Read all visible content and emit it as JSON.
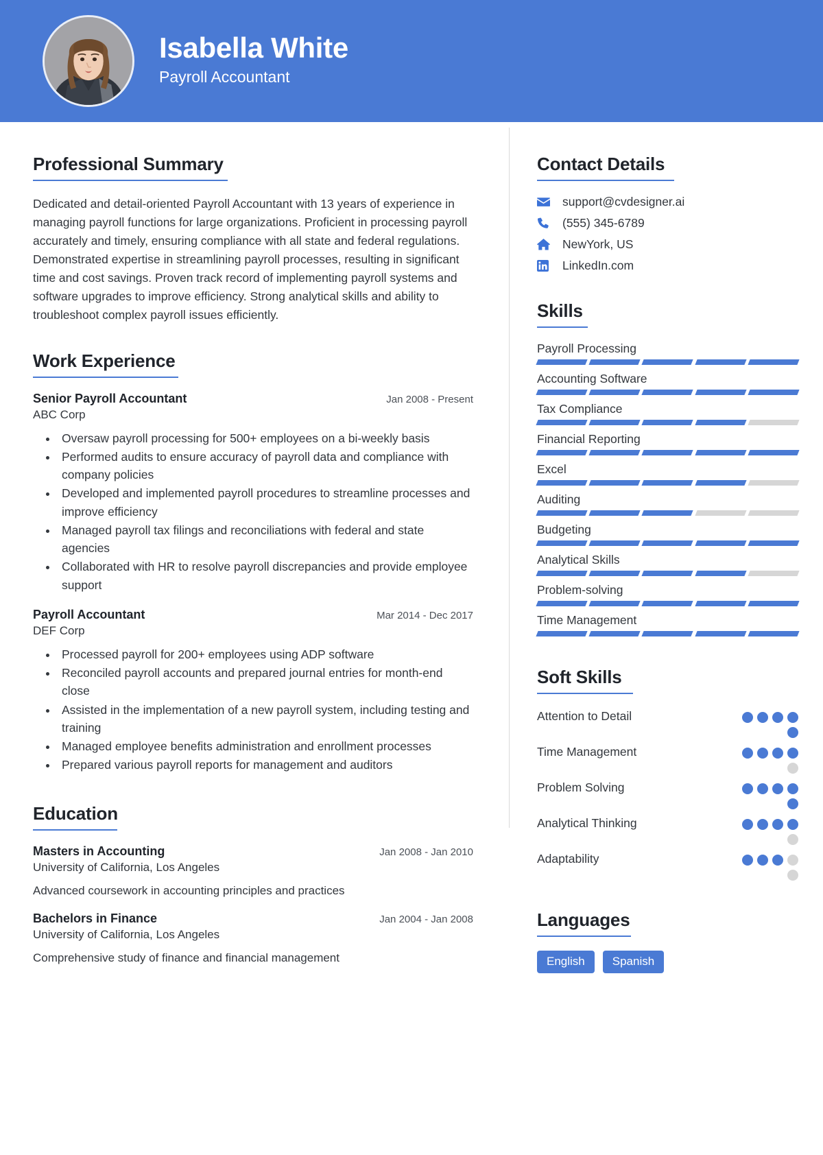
{
  "theme": {
    "accent": "#4a7ad4",
    "bar_empty": "#d6d6d6",
    "text": "#33373d"
  },
  "header": {
    "name": "Isabella White",
    "role": "Payroll Accountant"
  },
  "summary": {
    "heading": "Professional Summary",
    "text": "Dedicated and detail-oriented Payroll Accountant with 13 years of experience in managing payroll functions for large organizations. Proficient in processing payroll accurately and timely, ensuring compliance with all state and federal regulations. Demonstrated expertise in streamlining payroll processes, resulting in significant time and cost savings. Proven track record of implementing payroll systems and software upgrades to improve efficiency. Strong analytical skills and ability to troubleshoot complex payroll issues efficiently."
  },
  "work": {
    "heading": "Work Experience",
    "entries": [
      {
        "title": "Senior Payroll Accountant",
        "date": "Jan 2008 - Present",
        "company": "ABC Corp",
        "bullets": [
          "Oversaw payroll processing for 500+ employees on a bi-weekly basis",
          "Performed audits to ensure accuracy of payroll data and compliance with company policies",
          "Developed and implemented payroll procedures to streamline processes and improve efficiency",
          "Managed payroll tax filings and reconciliations with federal and state agencies",
          "Collaborated with HR to resolve payroll discrepancies and provide employee support"
        ]
      },
      {
        "title": "Payroll Accountant",
        "date": "Mar 2014 - Dec 2017",
        "company": "DEF Corp",
        "bullets": [
          "Processed payroll for 200+ employees using ADP software",
          "Reconciled payroll accounts and prepared journal entries for month-end close",
          "Assisted in the implementation of a new payroll system, including testing and training",
          "Managed employee benefits administration and enrollment processes",
          "Prepared various payroll reports for management and auditors"
        ]
      }
    ]
  },
  "education": {
    "heading": "Education",
    "entries": [
      {
        "degree": "Masters in Accounting",
        "date": "Jan 2008 - Jan 2010",
        "school": "University of California, Los Angeles",
        "note": "Advanced coursework in accounting principles and practices"
      },
      {
        "degree": "Bachelors in Finance",
        "date": "Jan 2004 - Jan 2008",
        "school": "University of California, Los Angeles",
        "note": "Comprehensive study of finance and financial management"
      }
    ]
  },
  "contact": {
    "heading": "Contact Details",
    "items": [
      {
        "icon": "envelope-icon",
        "value": "support@cvdesigner.ai"
      },
      {
        "icon": "phone-icon",
        "value": "(555) 345-6789"
      },
      {
        "icon": "home-icon",
        "value": "NewYork, US"
      },
      {
        "icon": "linkedin-icon",
        "value": "LinkedIn.com"
      }
    ]
  },
  "skills": {
    "heading": "Skills",
    "segments_total": 5,
    "items": [
      {
        "label": "Payroll Processing",
        "filled": 5
      },
      {
        "label": "Accounting Software",
        "filled": 5
      },
      {
        "label": "Tax Compliance",
        "filled": 4
      },
      {
        "label": "Financial Reporting",
        "filled": 5
      },
      {
        "label": "Excel",
        "filled": 4
      },
      {
        "label": "Auditing",
        "filled": 3
      },
      {
        "label": "Budgeting",
        "filled": 5
      },
      {
        "label": "Analytical Skills",
        "filled": 4
      },
      {
        "label": "Problem-solving",
        "filled": 5
      },
      {
        "label": "Time Management",
        "filled": 5
      }
    ]
  },
  "soft_skills": {
    "heading": "Soft Skills",
    "dots_total": 5,
    "items": [
      {
        "label": "Attention to Detail",
        "filled": 5
      },
      {
        "label": "Time Management",
        "filled": 4
      },
      {
        "label": "Problem Solving",
        "filled": 5
      },
      {
        "label": "Analytical Thinking",
        "filled": 4
      },
      {
        "label": "Adaptability",
        "filled": 3
      }
    ]
  },
  "languages": {
    "heading": "Languages",
    "items": [
      "English",
      "Spanish"
    ]
  }
}
